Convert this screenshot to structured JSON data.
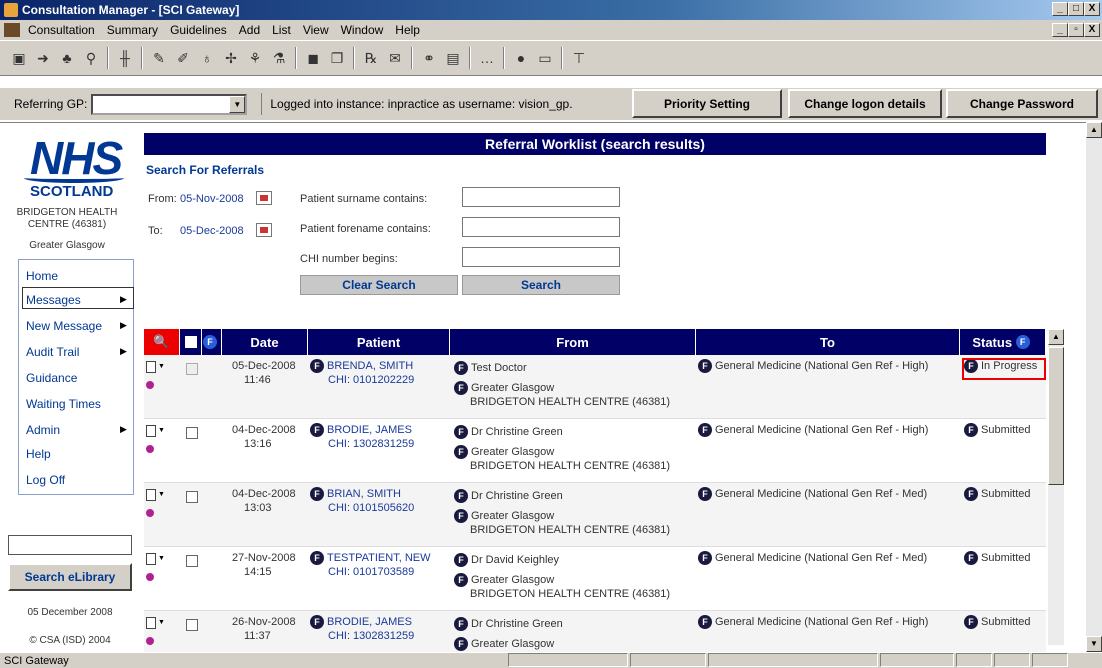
{
  "window": {
    "title": "Consultation Manager - [SCI Gateway]",
    "controls": [
      "_",
      "□",
      "X"
    ],
    "mdi_controls": [
      "_",
      "▫",
      "X"
    ]
  },
  "menu": [
    "Consultation",
    "Summary",
    "Guidelines",
    "Add",
    "List",
    "View",
    "Window",
    "Help"
  ],
  "gpbar": {
    "referring_label": "Referring GP:",
    "referring_value": "",
    "logged_in": "Logged into instance: inpractice as username: vision_gp.",
    "priority_setting": "Priority Setting",
    "change_logon": "Change logon details",
    "change_password": "Change Password"
  },
  "logo": {
    "nhs": "NHS",
    "scotland": "SCOTLAND",
    "practice": "BRIDGETON HEALTH CENTRE (46381)",
    "region": "Greater Glasgow"
  },
  "nav": [
    "Home",
    "Messages",
    "New Message",
    "Audit Trail",
    "Guidance",
    "Waiting Times",
    "Admin",
    "Help",
    "Log Off"
  ],
  "elibrary": {
    "button": "Search eLibrary",
    "date": "05 December 2008",
    "copyright": "© CSA (ISD) 2004"
  },
  "search": {
    "header": "Referral Worklist (search results)",
    "title": "Search For Referrals",
    "from_label": "From:",
    "from_date": "05-Nov-2008",
    "to_label": "To:",
    "to_date": "05-Dec-2008",
    "surname_label": "Patient surname contains:",
    "forename_label": "Patient forename contains:",
    "chi_label": "CHI number begins:",
    "clear_button": "Clear Search",
    "search_button": "Search"
  },
  "table": {
    "headers": {
      "date": "Date",
      "patient": "Patient",
      "from": "From",
      "to": "To",
      "status": "Status"
    },
    "f_badge": "F",
    "rows": [
      {
        "date": "05-Dec-2008",
        "time": "11:46",
        "patient": "BRENDA, SMITH",
        "chi": "CHI: 0101202229",
        "from_doctor": "Test Doctor",
        "from_region": "Greater Glasgow",
        "from_practice": "BRIDGETON HEALTH CENTRE (46381)",
        "to": "General Medicine (National Gen Ref - High)",
        "status": "In Progress"
      },
      {
        "date": "04-Dec-2008",
        "time": "13:16",
        "patient": "BRODIE, JAMES",
        "chi": "CHI: 1302831259",
        "from_doctor": "Dr Christine Green",
        "from_region": "Greater Glasgow",
        "from_practice": "BRIDGETON HEALTH CENTRE (46381)",
        "to": "General Medicine (National Gen Ref - High)",
        "status": "Submitted"
      },
      {
        "date": "04-Dec-2008",
        "time": "13:03",
        "patient": "BRIAN, SMITH",
        "chi": "CHI: 0101505620",
        "from_doctor": "Dr Christine Green",
        "from_region": "Greater Glasgow",
        "from_practice": "BRIDGETON HEALTH CENTRE (46381)",
        "to": "General Medicine (National Gen Ref - Med)",
        "status": "Submitted"
      },
      {
        "date": "27-Nov-2008",
        "time": "14:15",
        "patient": "TESTPATIENT, NEW",
        "chi": "CHI: 0101703589",
        "from_doctor": "Dr David Keighley",
        "from_region": "Greater Glasgow",
        "from_practice": "BRIDGETON HEALTH CENTRE (46381)",
        "to": "General Medicine (National Gen Ref - Med)",
        "status": "Submitted"
      },
      {
        "date": "26-Nov-2008",
        "time": "11:37",
        "patient": "BRODIE, JAMES",
        "chi": "CHI: 1302831259",
        "from_doctor": "Dr Christine Green",
        "from_region": "Greater Glasgow",
        "from_practice": "",
        "to": "General Medicine (National Gen Ref - High)",
        "status": "Submitted"
      }
    ]
  },
  "statusbar": {
    "text": "SCI Gateway"
  }
}
